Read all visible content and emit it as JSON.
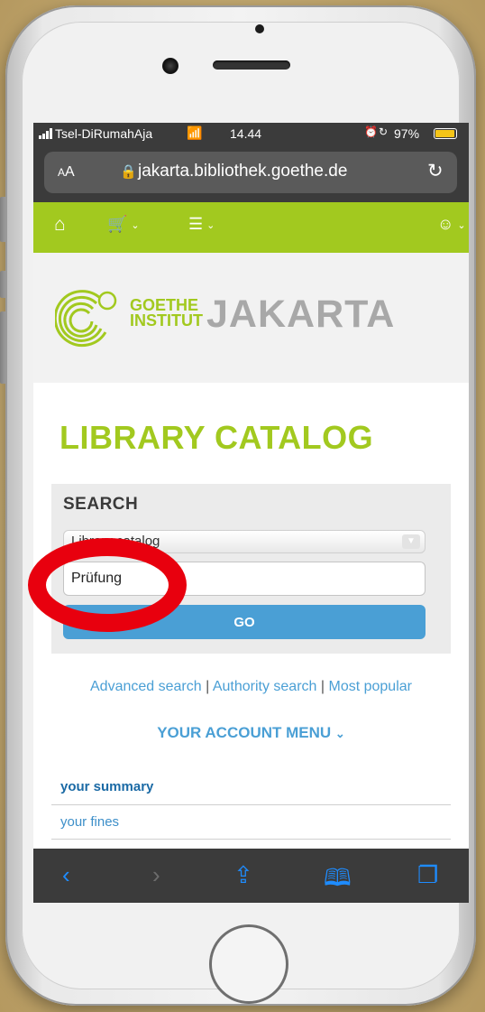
{
  "status_bar": {
    "carrier": "Tsel-DiRumahAja",
    "time": "14.44",
    "battery": "97%",
    "battery_level": 0.97
  },
  "browser": {
    "text_size_label": "AA",
    "url": "jakarta.bibliothek.goethe.de"
  },
  "header": {
    "logo_line1": "GOETHE",
    "logo_line2": "INSTITUT",
    "city": "JAKARTA"
  },
  "main": {
    "title": "LIBRARY CATALOG",
    "search_label": "SEARCH",
    "scope_value": "Library catalog",
    "query": "Prüfung",
    "go_label": "GO",
    "links": {
      "advanced": "Advanced search",
      "authority": "Authority search",
      "popular": "Most popular",
      "separator": "|"
    },
    "account_menu": "YOUR ACCOUNT MENU",
    "menu_items": [
      "your summary",
      "your fines"
    ]
  },
  "colors": {
    "brand_green": "#a2c91f",
    "link_blue": "#4a9fd5",
    "highlight_red": "#e8000e"
  },
  "icons": {
    "nav": [
      "home-icon",
      "cart-icon",
      "list-icon",
      "user-icon"
    ],
    "toolbar": [
      "back-icon",
      "forward-icon",
      "share-icon",
      "bookmarks-icon",
      "tabs-icon"
    ]
  }
}
